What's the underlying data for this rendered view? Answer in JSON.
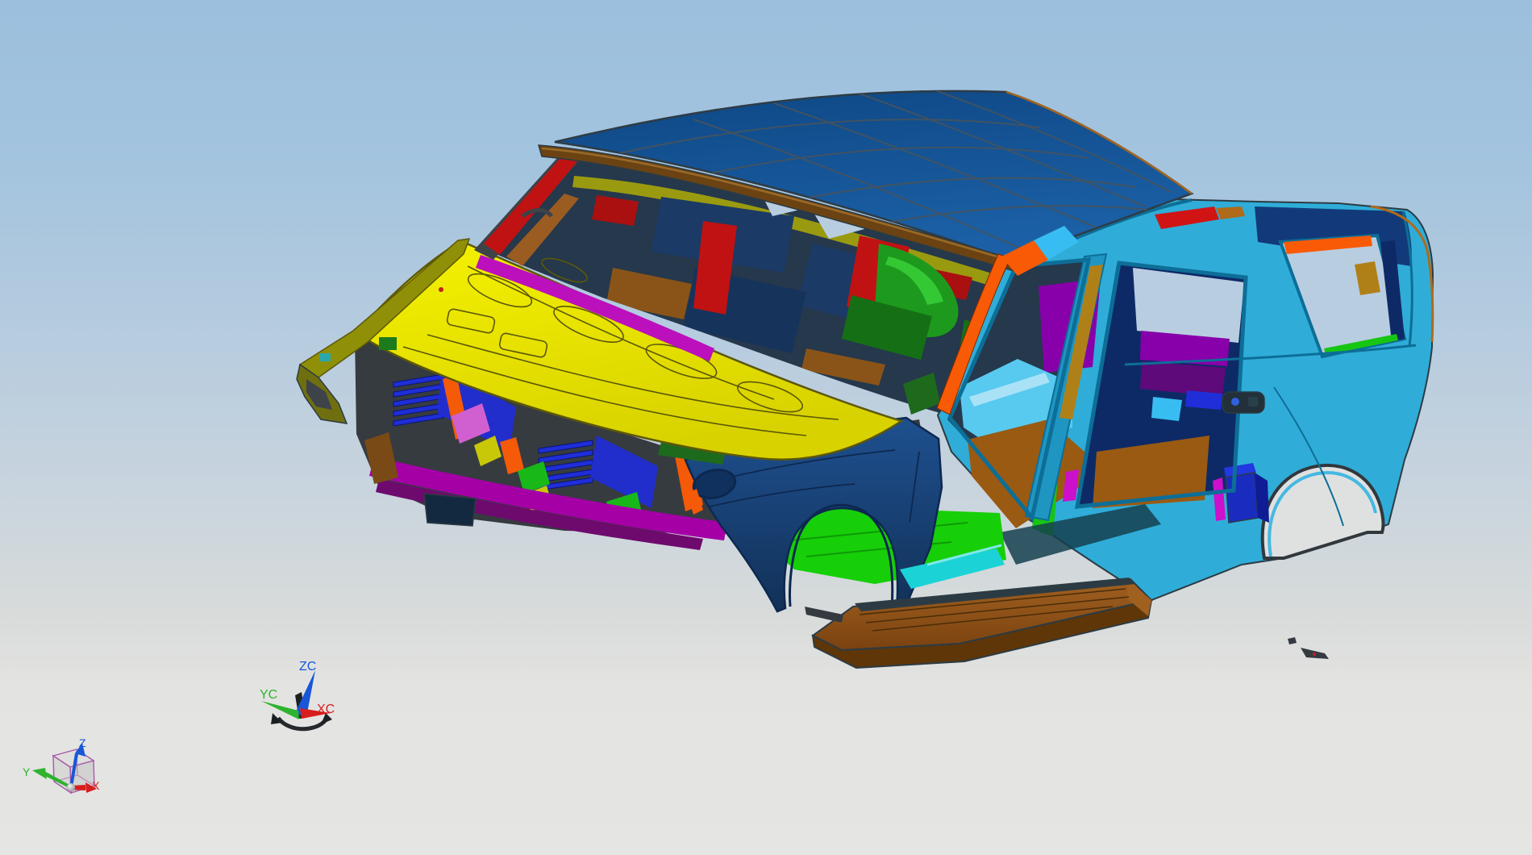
{
  "scene": {
    "type": "cad-3d-viewport",
    "model_subject": "suv body-in-white assembly, front-left 3/4 view"
  },
  "background": {
    "top": "#9bbfdd",
    "middle": "#c6d3de",
    "bottom": "#e5e5e3"
  },
  "wcs_triad": {
    "z_label": "ZC",
    "y_label": "YC",
    "x_label": "XC",
    "z_color": "#1757d8",
    "y_color": "#2db32d",
    "x_color": "#d81d1d",
    "handle_color": "#26292c"
  },
  "abs_triad": {
    "z_label": "Z",
    "y_label": "Y",
    "x_label": "X",
    "z_color": "#1757d8",
    "y_color": "#2db32d",
    "x_color": "#d81d1d",
    "cube_edge_color": "#a85aa8"
  },
  "colors": {
    "roof": "#11518f",
    "roof_line": "#46545e",
    "roof_edge": "#2e3c46",
    "header_brown": "#6b4312",
    "header_hi": "#9a6a28",
    "body_cyan": "#2fadd8",
    "body_line": "#0d6e97",
    "edge_dark": "#2c3b43",
    "rail_dark": "#28404a",
    "pillar_orange": "#f85a06",
    "patch_cyan": "#38bdf2",
    "patch_red": "#d01414",
    "apillar_red": "#c01212",
    "apillar_copper": "#9a5c20",
    "frame_dark": "#3d4348",
    "hood_yellow": "#f0ec00",
    "hood_line": "#5c5808",
    "fender_olive": "#8f8f08",
    "fender_olive_dark": "#6f6f10",
    "fender_navy": "#1b4a8c",
    "fender_line": "#0d2850",
    "pocket_navy": "#10305e",
    "grille_blue": "#1f2ed8",
    "grille_blue_dark": "#0a1670",
    "brace_orange": "#f45a08",
    "bumper_magenta": "#a400a6",
    "bumper_magenta_dark": "#6e0a6e",
    "bracket_brown": "#7a4a16",
    "clip_dark": "#363b40",
    "clip_yellow": "#c8c808",
    "clip_green": "#18b818",
    "clip_pink": "#d060d0",
    "airdam_navy": "#13293f",
    "floor_green": "#16cf08",
    "floor_green_dark": "#0f9a06",
    "floor_cyan": "#58c9ef",
    "floor_cyan_hi": "#a9e2f7",
    "tunnel_brown": "#9a5a12",
    "board_brown": "#8a5216",
    "board_brown_dark": "#5f3608",
    "board_hi": "#a06020",
    "sill_cyan": "#1bd3d6",
    "sill_aqua": "#7fe8ea",
    "rocker_shadow": "#15404f",
    "interior_dark": "#25384c",
    "interior_navy": "#1b3a66",
    "interior_navy2": "#16335c",
    "seat_green": "#1d9a1d",
    "seat_green_hi": "#35c835",
    "seat_green_dark": "#157015",
    "cowl_green": "#1d6a1d",
    "bar_purple": "#8800aa",
    "bar_purple_dark": "#5e0a7a",
    "cowl_magenta": "#bb10bb",
    "visor_olive": "#9a9a10",
    "box_red": "#aa1010",
    "dash_brown": "#8a5418",
    "sky": "#b9cde1",
    "arch_box_blue": "#1a2cc0",
    "arch_box_hi": "#2238e0",
    "arch_box_dark": "#0e1c96",
    "arch_bg": "#dfe1e0",
    "arch_rim": "#31383d",
    "arch_lip": "#45b8e2",
    "bpillar_olive": "#b08018",
    "bpillar_teal": "#1f95c2",
    "navy_band": "#123a7a",
    "navy_band_dark": "#0e2a66",
    "copper_rim": "#b06a1a",
    "magenta_sliver": "#cc10cc",
    "green_sliver": "#17c513",
    "handle_dark": "#22303a",
    "handle_blue": "#3060e0",
    "debris": "#343a40",
    "wiper_dark": "#2b3036",
    "hood_dot_red": "#c02020"
  }
}
